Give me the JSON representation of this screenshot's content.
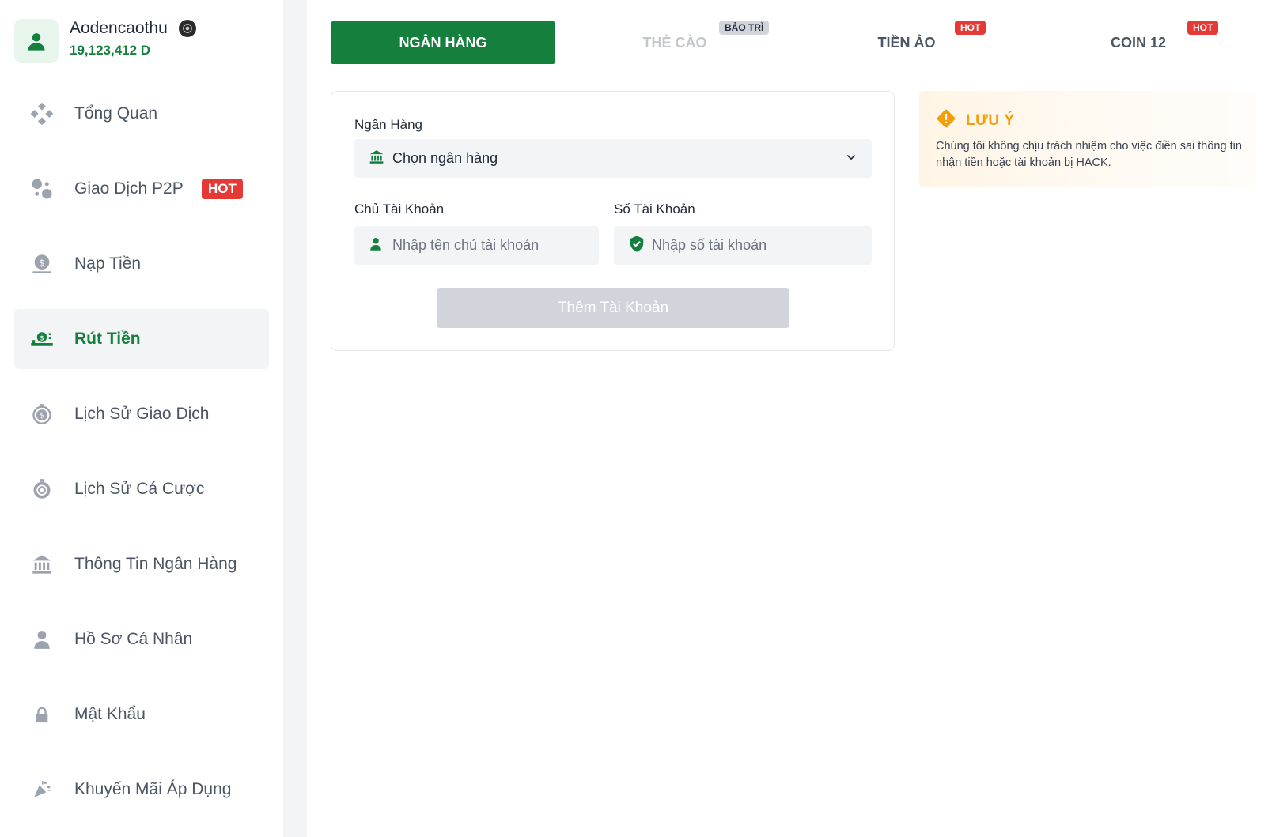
{
  "user": {
    "name": "Aodencaothu",
    "balance": "19,123,412 D"
  },
  "sidebar": {
    "items": [
      {
        "label": "Tổng Quan",
        "icon": "dashboard-icon"
      },
      {
        "label": "Giao Dịch P2P",
        "icon": "p2p-exchange-icon",
        "badge": "HOT"
      },
      {
        "label": "Nạp Tiền",
        "icon": "deposit-icon"
      },
      {
        "label": "Rút Tiền",
        "icon": "withdraw-icon",
        "active": true
      },
      {
        "label": "Lịch Sử Giao Dịch",
        "icon": "transaction-history-icon"
      },
      {
        "label": "Lịch Sử Cá Cược",
        "icon": "bet-history-icon"
      },
      {
        "label": "Thông Tin Ngân Hàng",
        "icon": "bank-icon"
      },
      {
        "label": "Hồ Sơ Cá Nhân",
        "icon": "user-icon"
      },
      {
        "label": "Mật Khẩu",
        "icon": "lock-icon"
      },
      {
        "label": "Khuyến Mãi Áp Dụng",
        "icon": "promotion-icon"
      }
    ]
  },
  "tabs": [
    {
      "label": "NGÂN HÀNG",
      "active": true
    },
    {
      "label": "THẺ CÀO",
      "badge": "BẢO TRÌ",
      "disabled": true
    },
    {
      "label": "TIỀN ẢO",
      "badge": "HOT"
    },
    {
      "label": "COIN 12",
      "badge": "HOT"
    }
  ],
  "form": {
    "bank_label": "Ngân Hàng",
    "bank_select_value": "Chọn ngân hàng",
    "holder_label": "Chủ Tài Khoản",
    "holder_placeholder": "Nhập tên chủ tài khoản",
    "number_label": "Số Tài Khoản",
    "number_placeholder": "Nhập số tài khoản",
    "submit_label": "Thêm Tài Khoản"
  },
  "note": {
    "title": "LƯU Ý",
    "text": "Chúng tôi không chịu trách nhiệm cho việc điền sai thông tin nhận tiền hoặc tài khoản bị HACK."
  },
  "colors": {
    "brand_green": "#15803d",
    "hot_red": "#e53935",
    "warning_orange": "#f59e0b"
  }
}
